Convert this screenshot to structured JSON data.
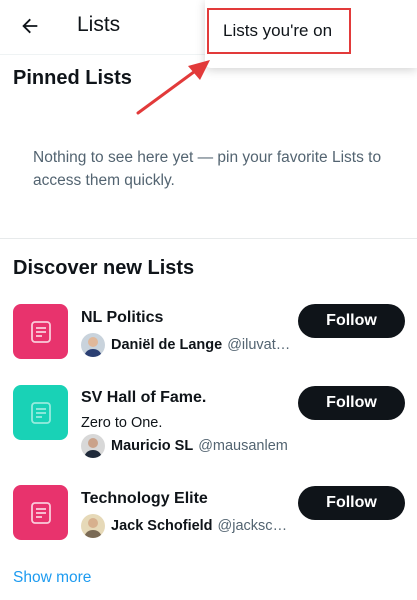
{
  "header": {
    "title": "Lists",
    "back_icon": "arrow-left-icon"
  },
  "menu": {
    "item_label": "Lists you're on"
  },
  "pinned": {
    "heading": "Pinned Lists",
    "empty_message": "Nothing to see here yet — pin your favorite Lists to access them quickly."
  },
  "discover": {
    "heading": "Discover new Lists",
    "items": [
      {
        "name": "NL Politics",
        "description": "",
        "owner_name": "Daniël de Lange",
        "owner_handle": "@iluvata...",
        "thumb_color": "#e8336d",
        "follow_label": "Follow"
      },
      {
        "name": "SV Hall of Fame.",
        "description": "Zero to One.",
        "owner_name": "Mauricio SL",
        "owner_handle": "@mausanlem",
        "thumb_color": "#19d2b6",
        "follow_label": "Follow"
      },
      {
        "name": "Technology Elite",
        "description": "",
        "owner_name": "Jack Schofield",
        "owner_handle": "@jacksch...",
        "thumb_color": "#e8336d",
        "follow_label": "Follow"
      }
    ],
    "show_more": "Show more"
  },
  "colors": {
    "accent_link": "#1d9bf0",
    "annotation": "#e23a3a",
    "follow_button": "#0f1419"
  }
}
